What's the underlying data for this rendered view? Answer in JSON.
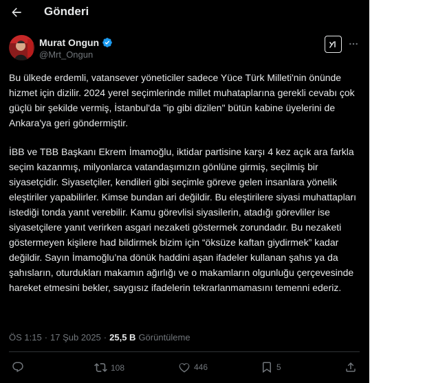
{
  "header": {
    "title": "Gönderi",
    "back_icon": "arrow-left-icon"
  },
  "post": {
    "author": {
      "display_name": "Murat Ongun",
      "handle": "@Mrt_Ongun",
      "verified": true,
      "verified_color": "#1d9bf0"
    },
    "paragraphs": [
      "Bu ülkede erdemli, vatansever yöneticiler sadece Yüce Türk Milleti'nin önünde hizmet için dizilir. 2024 yerel seçimlerinde millet muhataplarına gerekli cevabı çok güçlü bir şekilde vermiş, İstanbul'da \"ip gibi dizilen\" bütün kabine üyelerini de Ankara'ya geri göndermiştir.",
      "İBB ve TBB Başkanı Ekrem İmamoğlu, iktidar partisine karşı 4 kez açık ara farkla seçim kazanmış, milyonlarca vatandaşımızın gönlüne girmiş, seçilmiş bir siyasetçidir. Siyasetçiler, kendileri gibi seçimle göreve gelen insanlara yönelik eleştiriler yapabilirler. Kimse bundan ari değildir. Bu eleştirilere siyasi muhattapları istediği tonda yanıt verebilir. Kamu görevlisi siyasilerin, atadığı görevliler ise siyasetçilere yanıt verirken asgari nezaketi göstermek zorundadır. Bu nezaketi göstermeyen kişilere had bildirmek bizim için “öksüze kaftan giydirmek” kadar değildir. Sayın İmamoğlu’na dönük haddini aşan ifadeler kullanan şahıs ya da şahısların, oturdukları makamın ağırlığı ve o makamların olgunluğu çerçevesinde hareket etmesini bekler, saygısız ifadelerin tekrarlanmamasını temenni ederiz."
    ],
    "time": "ÖS 1:15",
    "separator": "·",
    "date": "17 Şub 2025",
    "views_count": "25,5 B",
    "views_label": "Görüntüleme"
  },
  "actions": {
    "reply": {
      "icon": "reply-icon",
      "count": ""
    },
    "repost": {
      "icon": "repost-icon",
      "count": "108"
    },
    "like": {
      "icon": "heart-icon",
      "count": "446"
    },
    "bookmark": {
      "icon": "bookmark-icon",
      "count": "5"
    },
    "share": {
      "icon": "share-icon",
      "count": ""
    }
  },
  "colors": {
    "background": "#000000",
    "text": "#e7e9ea",
    "muted": "#71767b",
    "divider": "#2f3336",
    "verified": "#1d9bf0"
  }
}
